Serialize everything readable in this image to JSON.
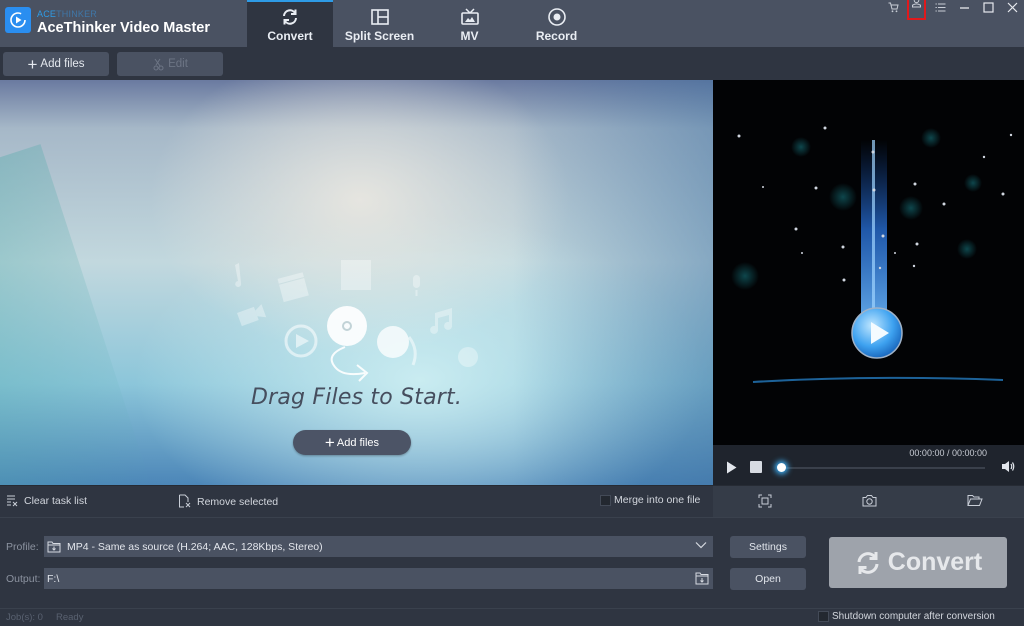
{
  "app": {
    "brand_prefix": "ACE",
    "brand_suffix": "THINKER",
    "title": "AceThinker Video Master"
  },
  "tabs": [
    {
      "label": "Convert",
      "icon": "refresh-icon",
      "active": true
    },
    {
      "label": "Split Screen",
      "icon": "split-screen-icon",
      "active": false
    },
    {
      "label": "MV",
      "icon": "tv-icon",
      "active": false
    },
    {
      "label": "Record",
      "icon": "record-icon",
      "active": false
    }
  ],
  "window_controls": [
    "cart-icon",
    "user-icon",
    "menu-icon",
    "minimize-icon",
    "maximize-icon",
    "close-icon"
  ],
  "toolbar": {
    "add_files": "Add files",
    "edit": "Edit"
  },
  "drop_area": {
    "title": "Drag Files to Start.",
    "add_files": "Add files"
  },
  "player": {
    "timecode": "00:00:00 / 00:00:00",
    "progress": 0
  },
  "tasks": {
    "clear": "Clear task list",
    "remove": "Remove selected",
    "merge": "Merge into one file",
    "merge_checked": false
  },
  "preview_tools": [
    "crop-icon",
    "snapshot-icon",
    "open-folder-icon"
  ],
  "settings": {
    "profile_label": "Profile:",
    "profile_value": "MP4 - Same as source (H.264; AAC, 128Kbps, Stereo)",
    "output_label": "Output:",
    "output_value": "F:\\",
    "settings_button": "Settings",
    "open_button": "Open",
    "convert_button": "Convert"
  },
  "status": {
    "jobs": "Job(s): 0",
    "state": "Ready",
    "shutdown": "Shutdown computer after conversion",
    "shutdown_checked": false
  },
  "colors": {
    "accent": "#2e9be6",
    "titlebar": "#4a5262",
    "background": "#2f3541",
    "highlight_box": "#e0191c"
  }
}
